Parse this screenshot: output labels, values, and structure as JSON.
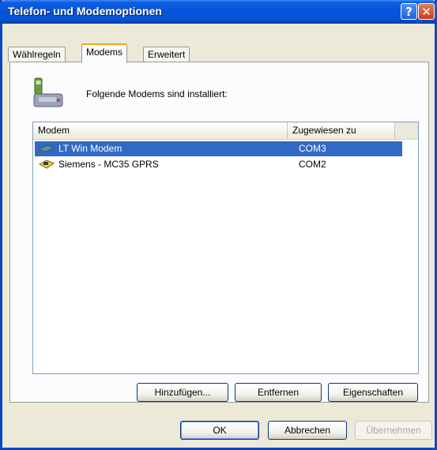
{
  "window": {
    "title": "Telefon- und Modemoptionen",
    "help_glyph": "?",
    "close_glyph": "✕"
  },
  "tabs": [
    {
      "label": "Wählregeln",
      "active": false
    },
    {
      "label": "Modems",
      "active": true
    },
    {
      "label": "Erweitert",
      "active": false
    }
  ],
  "panel": {
    "installed_label": "Folgende Modems sind installiert:",
    "icon": "phone-modem-icon"
  },
  "listview": {
    "columns": [
      "Modem",
      "Zugewiesen zu"
    ],
    "rows": [
      {
        "modem": "LT Win Modem",
        "port": "COM3",
        "selected": true,
        "icon": "modem-card-icon"
      },
      {
        "modem": "Siemens - MC35 GPRS",
        "port": "COM2",
        "selected": false,
        "icon": "phone-modem-small-icon"
      }
    ]
  },
  "panel_buttons": {
    "add": "Hinzufügen...",
    "remove": "Entfernen",
    "properties": "Eigenschaften"
  },
  "dialog_buttons": {
    "ok": "OK",
    "cancel": "Abbrechen",
    "apply": "Übernehmen"
  },
  "colors": {
    "titlebar": "#0653d8",
    "selection": "#316ac5",
    "tab_highlight": "#f0a322",
    "dialog_bg": "#ece9d8"
  }
}
